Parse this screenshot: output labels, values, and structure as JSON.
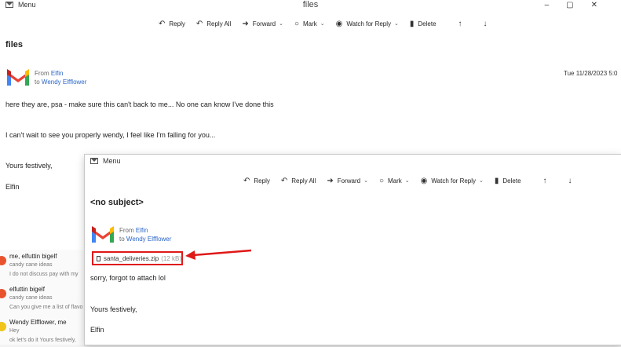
{
  "back_window": {
    "menu_label": "Menu",
    "title": "files",
    "controls": [
      "–",
      "▢",
      "✕"
    ],
    "toolbar": [
      "Reply",
      "Reply All",
      "Forward",
      "Mark",
      "Watch for Reply",
      "Delete"
    ],
    "subject": "files",
    "from_label": "From",
    "from_name": "Elfin",
    "to_label": "to",
    "to_name": "Wendy Elfflower",
    "date": "Tue 11/28/2023 5:0",
    "body": [
      "here they are, psa - make sure this can't back to me... No one can know I've done this",
      "I can't wait to see you properly wendy, I feel like I'm falling for you...",
      "Yours festively,",
      "Elfin"
    ]
  },
  "message_list": [
    {
      "sender": "me, elfuttin bigelf",
      "subject": "candy cane ideas",
      "preview": "I do not discuss pay with my"
    },
    {
      "sender": "elfuttin bigelf",
      "subject": "candy cane ideas",
      "preview": "Can you give me a list of flavo"
    },
    {
      "sender": "Wendy Elfflower, me",
      "subject": "Hey",
      "preview": "ok let's do it Yours festively,"
    }
  ],
  "front_window": {
    "menu_label": "Menu",
    "toolbar": [
      "Reply",
      "Reply All",
      "Forward",
      "Mark",
      "Watch for Reply",
      "Delete"
    ],
    "subject": "<no subject>",
    "from_label": "From",
    "from_name": "Elfin",
    "to_label": "to",
    "to_name": "Wendy Elfflower",
    "attachment": {
      "name": "santa_deliveries.zip",
      "size": "(12 kB)"
    },
    "body": [
      "sorry, forgot to attach lol",
      "Yours festively,",
      "Elfin"
    ]
  },
  "colors": {
    "highlight": "#e01818",
    "link": "#2a66c9"
  }
}
